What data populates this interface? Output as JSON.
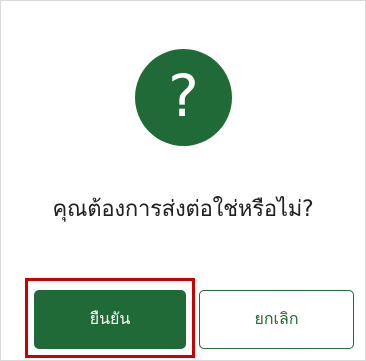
{
  "dialog": {
    "icon": "question-mark-icon",
    "icon_glyph": "?",
    "message": "คุณต้องการส่งต่อใช่หรือไม่?",
    "confirm_label": "ยืนยัน",
    "cancel_label": "ยกเลิก"
  },
  "colors": {
    "primary": "#1f6a36",
    "highlight": "#cc0000",
    "text": "#202020"
  }
}
